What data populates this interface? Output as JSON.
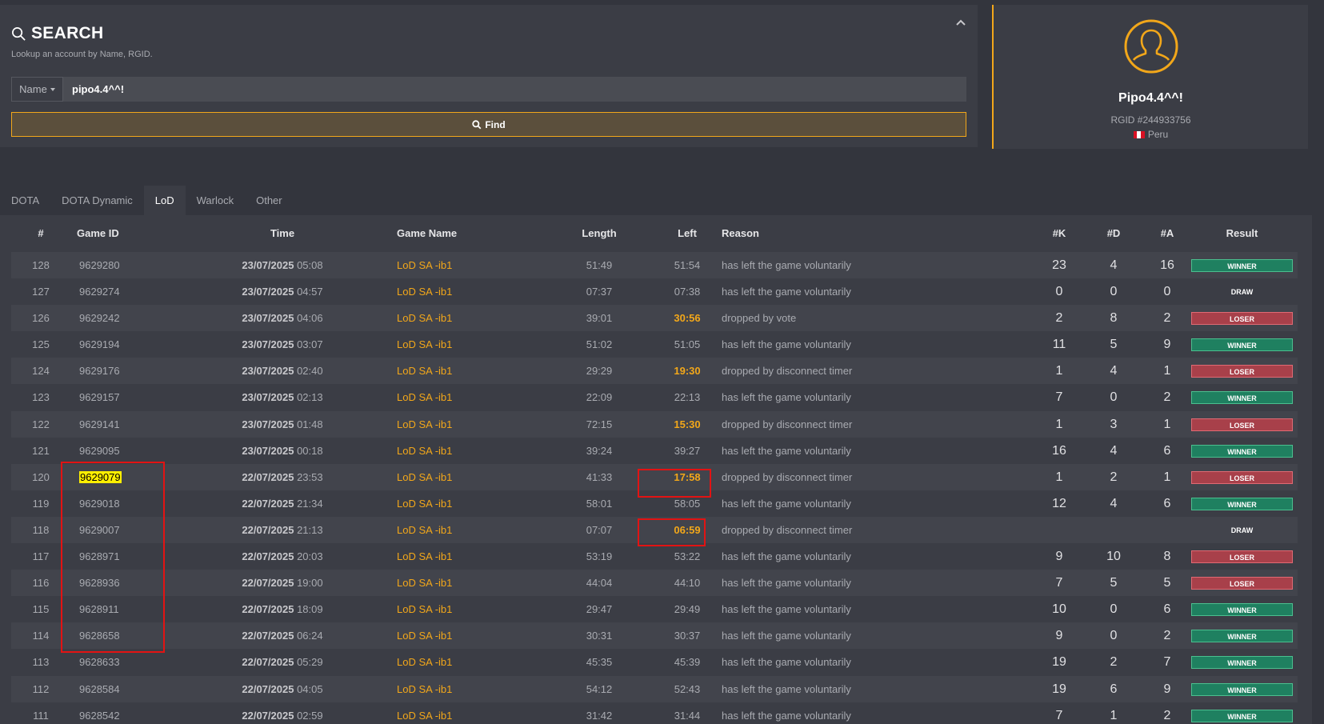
{
  "search": {
    "title": "SEARCH",
    "subtitle": "Lookup an account by Name, RGID.",
    "type_label": "Name",
    "query": "pipo4.4^^!",
    "find_label": "Find"
  },
  "profile": {
    "name": "Pipo4.4^^!",
    "rgid": "RGID #244933756",
    "country": "Peru"
  },
  "tabs": [
    "DOTA",
    "DOTA Dynamic",
    "LoD",
    "Warlock",
    "Other"
  ],
  "active_tab": "LoD",
  "columns": {
    "num": "#",
    "game_id": "Game ID",
    "time": "Time",
    "game_name": "Game Name",
    "length": "Length",
    "left": "Left",
    "reason": "Reason",
    "k": "#K",
    "d": "#D",
    "a": "#A",
    "result": "Result"
  },
  "rows": [
    {
      "num": "128",
      "id": "9629280",
      "date": "23/07/2025",
      "clock": "05:08",
      "name": "LoD SA -ib1",
      "length": "51:49",
      "left": "51:54",
      "left_warn": false,
      "reason": "has left the game voluntarily",
      "k": "23",
      "d": "4",
      "a": "16",
      "result": "WINNER"
    },
    {
      "num": "127",
      "id": "9629274",
      "date": "23/07/2025",
      "clock": "04:57",
      "name": "LoD SA -ib1",
      "length": "07:37",
      "left": "07:38",
      "left_warn": false,
      "reason": "has left the game voluntarily",
      "k": "0",
      "d": "0",
      "a": "0",
      "result": "DRAW"
    },
    {
      "num": "126",
      "id": "9629242",
      "date": "23/07/2025",
      "clock": "04:06",
      "name": "LoD SA -ib1",
      "length": "39:01",
      "left": "30:56",
      "left_warn": true,
      "reason": "dropped by vote",
      "k": "2",
      "d": "8",
      "a": "2",
      "result": "LOSER"
    },
    {
      "num": "125",
      "id": "9629194",
      "date": "23/07/2025",
      "clock": "03:07",
      "name": "LoD SA -ib1",
      "length": "51:02",
      "left": "51:05",
      "left_warn": false,
      "reason": "has left the game voluntarily",
      "k": "11",
      "d": "5",
      "a": "9",
      "result": "WINNER"
    },
    {
      "num": "124",
      "id": "9629176",
      "date": "23/07/2025",
      "clock": "02:40",
      "name": "LoD SA -ib1",
      "length": "29:29",
      "left": "19:30",
      "left_warn": true,
      "reason": "dropped by disconnect timer",
      "k": "1",
      "d": "4",
      "a": "1",
      "result": "LOSER"
    },
    {
      "num": "123",
      "id": "9629157",
      "date": "23/07/2025",
      "clock": "02:13",
      "name": "LoD SA -ib1",
      "length": "22:09",
      "left": "22:13",
      "left_warn": false,
      "reason": "has left the game voluntarily",
      "k": "7",
      "d": "0",
      "a": "2",
      "result": "WINNER"
    },
    {
      "num": "122",
      "id": "9629141",
      "date": "23/07/2025",
      "clock": "01:48",
      "name": "LoD SA -ib1",
      "length": "72:15",
      "left": "15:30",
      "left_warn": true,
      "reason": "dropped by disconnect timer",
      "k": "1",
      "d": "3",
      "a": "1",
      "result": "LOSER"
    },
    {
      "num": "121",
      "id": "9629095",
      "date": "23/07/2025",
      "clock": "00:18",
      "name": "LoD SA -ib1",
      "length": "39:24",
      "left": "39:27",
      "left_warn": false,
      "reason": "has left the game voluntarily",
      "k": "16",
      "d": "4",
      "a": "6",
      "result": "WINNER"
    },
    {
      "num": "120",
      "id": "9629079",
      "date": "22/07/2025",
      "clock": "23:53",
      "name": "LoD SA -ib1",
      "length": "41:33",
      "left": "17:58",
      "left_warn": true,
      "reason": "dropped by disconnect timer",
      "k": "1",
      "d": "2",
      "a": "1",
      "result": "LOSER",
      "id_highlight": true
    },
    {
      "num": "119",
      "id": "9629018",
      "date": "22/07/2025",
      "clock": "21:34",
      "name": "LoD SA -ib1",
      "length": "58:01",
      "left": "58:05",
      "left_warn": false,
      "reason": "has left the game voluntarily",
      "k": "12",
      "d": "4",
      "a": "6",
      "result": "WINNER"
    },
    {
      "num": "118",
      "id": "9629007",
      "date": "22/07/2025",
      "clock": "21:13",
      "name": "LoD SA -ib1",
      "length": "07:07",
      "left": "06:59",
      "left_warn": true,
      "reason": "dropped by disconnect timer",
      "k": "",
      "d": "",
      "a": "",
      "result": "DRAW"
    },
    {
      "num": "117",
      "id": "9628971",
      "date": "22/07/2025",
      "clock": "20:03",
      "name": "LoD SA -ib1",
      "length": "53:19",
      "left": "53:22",
      "left_warn": false,
      "reason": "has left the game voluntarily",
      "k": "9",
      "d": "10",
      "a": "8",
      "result": "LOSER"
    },
    {
      "num": "116",
      "id": "9628936",
      "date": "22/07/2025",
      "clock": "19:00",
      "name": "LoD SA -ib1",
      "length": "44:04",
      "left": "44:10",
      "left_warn": false,
      "reason": "has left the game voluntarily",
      "k": "7",
      "d": "5",
      "a": "5",
      "result": "LOSER"
    },
    {
      "num": "115",
      "id": "9628911",
      "date": "22/07/2025",
      "clock": "18:09",
      "name": "LoD SA -ib1",
      "length": "29:47",
      "left": "29:49",
      "left_warn": false,
      "reason": "has left the game voluntarily",
      "k": "10",
      "d": "0",
      "a": "6",
      "result": "WINNER"
    },
    {
      "num": "114",
      "id": "9628658",
      "date": "22/07/2025",
      "clock": "06:24",
      "name": "LoD SA -ib1",
      "length": "30:31",
      "left": "30:37",
      "left_warn": false,
      "reason": "has left the game voluntarily",
      "k": "9",
      "d": "0",
      "a": "2",
      "result": "WINNER"
    },
    {
      "num": "113",
      "id": "9628633",
      "date": "22/07/2025",
      "clock": "05:29",
      "name": "LoD SA -ib1",
      "length": "45:35",
      "left": "45:39",
      "left_warn": false,
      "reason": "has left the game voluntarily",
      "k": "19",
      "d": "2",
      "a": "7",
      "result": "WINNER"
    },
    {
      "num": "112",
      "id": "9628584",
      "date": "22/07/2025",
      "clock": "04:05",
      "name": "LoD SA -ib1",
      "length": "54:12",
      "left": "52:43",
      "left_warn": false,
      "reason": "has left the game voluntarily",
      "k": "19",
      "d": "6",
      "a": "9",
      "result": "WINNER"
    },
    {
      "num": "111",
      "id": "9628542",
      "date": "22/07/2025",
      "clock": "02:59",
      "name": "LoD SA -ib1",
      "length": "31:42",
      "left": "31:44",
      "left_warn": false,
      "reason": "has left the game voluntarily",
      "k": "7",
      "d": "1",
      "a": "2",
      "result": "WINNER"
    }
  ],
  "colors": {
    "accent": "#f2a71a",
    "winner": "#1f8060",
    "loser": "#a8404a",
    "annotation": "#e21313",
    "highlight": "#ffef00"
  },
  "icons": {
    "search": "search-icon",
    "collapse": "chevron-up-icon",
    "avatar": "user-icon",
    "flag": "peru-flag-icon"
  }
}
